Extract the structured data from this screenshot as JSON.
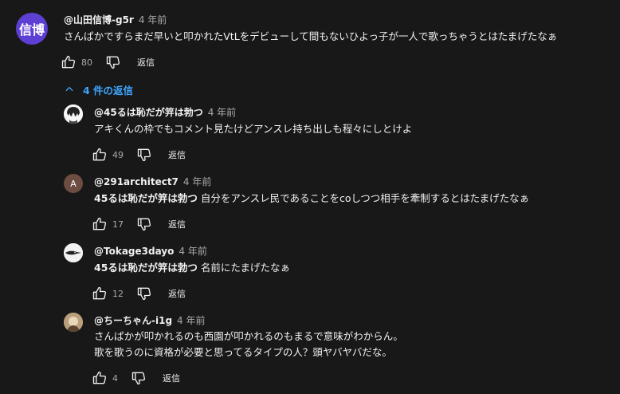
{
  "main_comment": {
    "avatar_text": "信博",
    "author": "@山田信博-g5r",
    "time": "4 年前",
    "text": "さんぱかですらまだ早いと叩かれたVtLをデビューして間もないひよっ子が一人で歌っちゃうとはたまげたなぁ",
    "likes": "80",
    "reply_label": "返信"
  },
  "replies_toggle": "4 件の返信",
  "replies": [
    {
      "author": "@45るは恥だが笄は勃つ",
      "time": "4 年前",
      "mention": "",
      "text": "アキくんの枠でもコメント見たけどアンスレ持ち出しも程々にしとけよ",
      "likes": "49",
      "reply_label": "返信"
    },
    {
      "avatar_text": "A",
      "author": "@291architect7",
      "time": "4 年前",
      "mention": "45るは恥だが笄は勃つ",
      "text": " 自分をアンスレ民であることをcoしつつ相手を牽制するとはたまげたなぁ",
      "likes": "17",
      "reply_label": "返信"
    },
    {
      "author": "@Tokage3dayo",
      "time": "4 年前",
      "mention": "45るは恥だが笄は勃つ",
      "text": " 名前にたまげたなぁ",
      "likes": "12",
      "reply_label": "返信"
    },
    {
      "author": "@ちーちゃん-i1g",
      "time": "4 年前",
      "mention": "",
      "text": "さんぱかが叩かれるのも西園が叩かれるのもまるで意味がわからん。",
      "text2": "歌を歌うのに資格が必要と思ってるタイプの人？頭ヤバヤバだな。",
      "likes": "4",
      "reply_label": "返信"
    }
  ],
  "colors": {
    "background": "#181818",
    "link": "#3ea6ff",
    "avatar_main": "#5d3fd3",
    "avatar_a": "#6d4c41"
  },
  "icons": [
    "like-icon",
    "dislike-icon",
    "chevron-up-icon"
  ]
}
